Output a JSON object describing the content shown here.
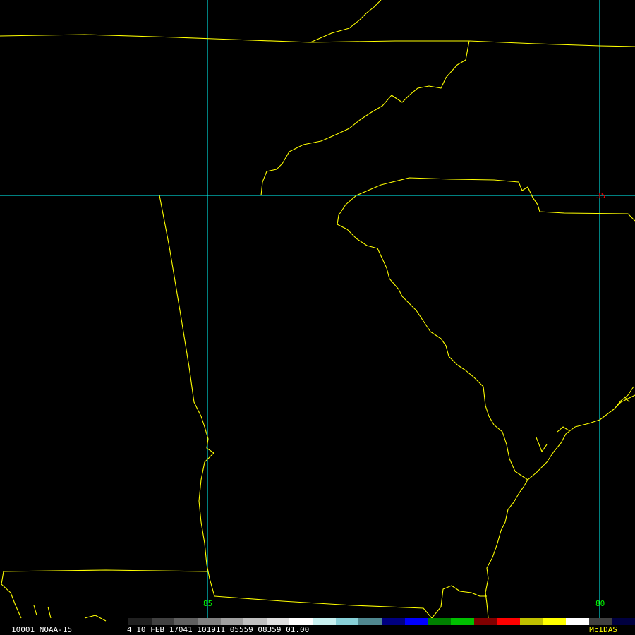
{
  "status": {
    "left": "10001 NOAA-15",
    "right": "4 10 FEB 17041 101911 05559 08359 01.00",
    "brand": "McIDAS"
  },
  "grid": {
    "lat_label": "35",
    "lon_labels": [
      "85",
      "80"
    ],
    "line_color": "#00ffff",
    "lat_label_color": "#ff0000",
    "lon_label_color": "#00ff00"
  },
  "colors": {
    "background": "#000000",
    "border_color": "#ffff00"
  },
  "colorbar": [
    "#202020",
    "#404040",
    "#606060",
    "#808080",
    "#a0a0a0",
    "#c0c0c0",
    "#e0e0e0",
    "#ffffff",
    "#c8f0f0",
    "#88d0d8",
    "#508890",
    "#000080",
    "#0000ff",
    "#008000",
    "#00c000",
    "#800000",
    "#ff0000",
    "#c0c000",
    "#ffff00",
    "#ffffff",
    "#404040",
    "#000040"
  ]
}
